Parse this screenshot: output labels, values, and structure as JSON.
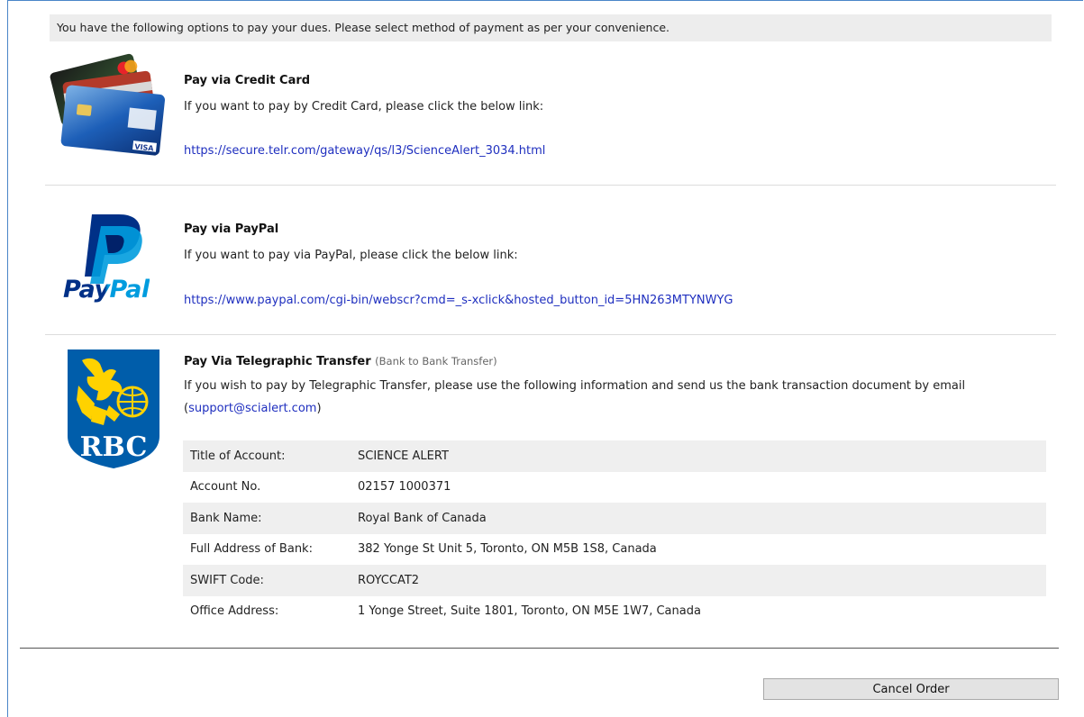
{
  "intro": "You have the following options to pay your dues. Please select method of payment as per your convenience.",
  "credit_card": {
    "title": "Pay via Credit Card",
    "desc": "If you want to pay by Credit Card, please click the below link:",
    "link": "https://secure.telr.com/gateway/qs/l3/ScienceAlert_3034.html",
    "icon": "credit-cards-icon"
  },
  "paypal": {
    "title": "Pay via PayPal",
    "desc": "If you want to pay via PayPal, please click the below link:",
    "link": "https://www.paypal.com/cgi-bin/webscr?cmd=_s-xclick&hosted_button_id=5HN263MTYNWYG",
    "logo_text": "PayPal",
    "colors": {
      "dark": "#003087",
      "light": "#009cde"
    }
  },
  "telegraphic": {
    "title": "Pay Via Telegraphic Transfer",
    "subtitle": "(Bank to Bank Transfer)",
    "desc_before": "If you wish to pay by Telegraphic Transfer, please use the following information and send us the bank transaction document by email (",
    "email": "support@scialert.com",
    "desc_after": ")",
    "logo_text": "RBC",
    "colors": {
      "blue": "#005daa",
      "yellow": "#ffd200"
    },
    "rows": [
      {
        "label": "Title of Account:",
        "value": "SCIENCE ALERT"
      },
      {
        "label": "Account No.",
        "value": "02157 1000371"
      },
      {
        "label": "Bank Name:",
        "value": "Royal Bank of Canada"
      },
      {
        "label": "Full Address of Bank:",
        "value": "382 Yonge St Unit 5, Toronto, ON M5B 1S8, Canada"
      },
      {
        "label": "SWIFT Code:",
        "value": "ROYCCAT2"
      },
      {
        "label": "Office Address:",
        "value": "1 Yonge Street, Suite 1801, Toronto, ON M5E 1W7, Canada"
      }
    ]
  },
  "cancel_label": "Cancel Order"
}
